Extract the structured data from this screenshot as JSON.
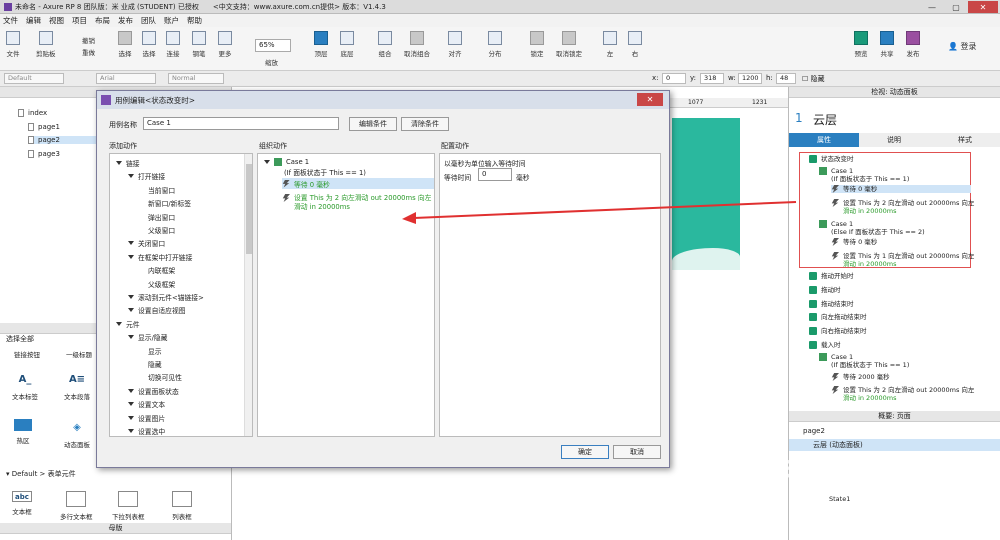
{
  "window": {
    "title": "未命名 - Axure RP 8 团队版：米 业成 (STUDENT) 已授权　　<中文支持：www.axure.com.cn提供> 版本：V1.4.3"
  },
  "menu": [
    "文件",
    "编辑",
    "视图",
    "项目",
    "布局",
    "发布",
    "团队",
    "账户",
    "帮助"
  ],
  "toolbar": {
    "file": "文件",
    "clipboard": "剪贴板",
    "undo": "撤销",
    "redo": "重做",
    "select": "选择",
    "connect": "连接",
    "pen": "钢笔",
    "more": "更多",
    "zoom_value": "65%",
    "zoom_label": "缩放",
    "top": "顶层",
    "bottom": "底层",
    "group": "组合",
    "ungroup": "取消组合",
    "align": "对齐",
    "distribute": "分布",
    "lock": "锁定",
    "unlock": "取消锁定",
    "left": "左",
    "right": "右",
    "preview": "预览",
    "share": "共享",
    "publish": "发布",
    "login": "登录"
  },
  "formatbar": {
    "style": "Default",
    "font": "Arial",
    "weight": "Normal",
    "x_label": "x:",
    "x_value": "0",
    "y_label": "y:",
    "y_value": "318",
    "w_label": "w:",
    "w_value": "1200",
    "h_label": "h:",
    "h_value": "48",
    "hidden": "隐藏"
  },
  "pages": {
    "root": "index",
    "items": [
      "page1",
      "page2",
      "page3"
    ]
  },
  "widgets": {
    "section_title": "选择全部",
    "row0": [
      "链接按钮",
      "一级标题"
    ],
    "row1": [
      "文本标签",
      "文本段落"
    ],
    "row2": [
      "热区",
      "动态面板"
    ],
    "form_header": "Default > 表单元件",
    "form": [
      "文本框",
      "多行文本框",
      "下拉列表框",
      "列表框"
    ],
    "footer": "母版"
  },
  "ruler": {
    "left": "1077",
    "right": "1231"
  },
  "dialog": {
    "title": "用例编辑<状态改变时>",
    "case_label": "用例名称",
    "case_value": "Case 1",
    "edit_condition": "编辑条件",
    "clear_condition": "清除条件",
    "add_action": "添加动作",
    "organize_action": "组织动作",
    "configure_action": "配置动作",
    "actions": [
      {
        "label": "链接",
        "lvl": 0
      },
      {
        "label": "打开链接",
        "lvl": 1
      },
      {
        "label": "当前窗口",
        "lvl": 2
      },
      {
        "label": "新窗口/新标签",
        "lvl": 2
      },
      {
        "label": "弹出窗口",
        "lvl": 2
      },
      {
        "label": "父级窗口",
        "lvl": 2
      },
      {
        "label": "关闭窗口",
        "lvl": 1
      },
      {
        "label": "在框架中打开链接",
        "lvl": 1
      },
      {
        "label": "内联框架",
        "lvl": 2
      },
      {
        "label": "父级框架",
        "lvl": 2
      },
      {
        "label": "滚动到元件<锚链接>",
        "lvl": 1
      },
      {
        "label": "设置自适应视图",
        "lvl": 1
      },
      {
        "label": "元件",
        "lvl": 0
      },
      {
        "label": "显示/隐藏",
        "lvl": 1
      },
      {
        "label": "显示",
        "lvl": 2
      },
      {
        "label": "隐藏",
        "lvl": 2
      },
      {
        "label": "切换可见性",
        "lvl": 2
      },
      {
        "label": "设置面板状态",
        "lvl": 1
      },
      {
        "label": "设置文本",
        "lvl": 1
      },
      {
        "label": "设置图片",
        "lvl": 1
      },
      {
        "label": "设置选中",
        "lvl": 1
      }
    ],
    "org": {
      "case": "Case 1",
      "condition": "(If 面板状态于 This == 1)",
      "wait": "等待 0 毫秒",
      "set1": "设置 This 为 2 向左滑动 out 20000ms 向左",
      "set2": "滑动 in 20000ms"
    },
    "config": {
      "desc": "以毫秒为单位输入等待时间",
      "wait_label": "等待时间",
      "wait_value": "0",
      "unit": "毫秒"
    },
    "ok": "确定",
    "cancel": "取消"
  },
  "rightpanel": {
    "header": "检视: 动态面板",
    "index": "1",
    "name": "云层",
    "tabs": [
      "属性",
      "说明",
      "样式"
    ],
    "events": {
      "state_change": "状态改变时",
      "c1": "Case 1",
      "c1cond": "(If 面板状态于 This == 1)",
      "c1wait": "等待 0 毫秒",
      "c1set1": "设置 This 为 2 向左滑动 out 20000ms 向左",
      "c1set2": "滑动 in 20000ms",
      "c2": "Case 1",
      "c2cond": "(Else If 面板状态于 This == 2)",
      "c2wait": "等待 0 毫秒",
      "c2set1": "设置 This 为 1 向左滑动 out 20000ms 向左",
      "c2set2": "滑动 in 20000ms",
      "drag_start": "拖动开始时",
      "drag": "拖动时",
      "drag_end": "拖动结束时",
      "swipe_left": "向左拖动结束时",
      "swipe_right": "向右拖动结束时",
      "load": "载入时",
      "l1": "Case 1",
      "l1cond": "(If 面板状态于 This == 1)",
      "l1wait": "等待 2000 毫秒",
      "l1set1": "设置 This 为 2 向左滑动 out 20000ms 向左",
      "l1set2": "滑动 in 20000ms"
    },
    "outline_header": "概要: 页面",
    "outline_page": "page2",
    "outline_item": "云层 (动态面板)",
    "outline_state": "State1"
  },
  "watermark": "aid"
}
